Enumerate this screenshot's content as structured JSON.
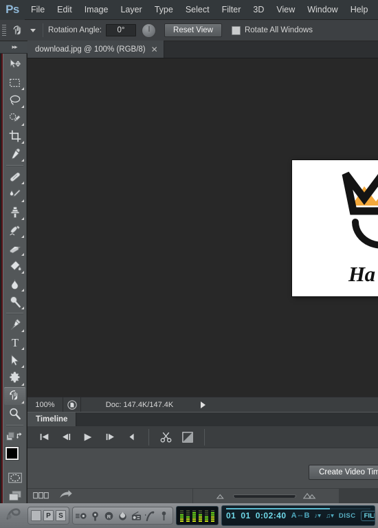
{
  "app": {
    "name": "Adobe Photoshop",
    "logo_text": "Ps"
  },
  "menubar": {
    "items": [
      {
        "label": "File"
      },
      {
        "label": "Edit"
      },
      {
        "label": "Image"
      },
      {
        "label": "Layer"
      },
      {
        "label": "Type"
      },
      {
        "label": "Select"
      },
      {
        "label": "Filter"
      },
      {
        "label": "3D"
      },
      {
        "label": "View"
      },
      {
        "label": "Window"
      },
      {
        "label": "Help"
      }
    ]
  },
  "options_bar": {
    "active_tool_icon": "rotate-view-tool-icon",
    "rotation_angle_label": "Rotation Angle:",
    "rotation_angle_value": "0°",
    "dial_icon": "rotation-dial-icon",
    "reset_view_label": "Reset View",
    "rotate_all_windows_label": "Rotate All Windows",
    "rotate_all_windows_checked": false
  },
  "toolbar": {
    "collapse_icon": "double-chevron-right-icon",
    "tools": [
      {
        "name": "move-tool",
        "icon": "move-tool-icon",
        "active": false,
        "has_submenu": false
      },
      {
        "name": "rectangular-marquee-tool",
        "icon": "marquee-tool-icon",
        "active": false,
        "has_submenu": true
      },
      {
        "name": "lasso-tool",
        "icon": "lasso-tool-icon",
        "active": false,
        "has_submenu": true
      },
      {
        "name": "quick-selection-tool",
        "icon": "quick-selection-tool-icon",
        "active": false,
        "has_submenu": true
      },
      {
        "name": "crop-tool",
        "icon": "crop-tool-icon",
        "active": false,
        "has_submenu": true
      },
      {
        "name": "eyedropper-tool",
        "icon": "eyedropper-tool-icon",
        "active": false,
        "has_submenu": true
      },
      {
        "name": "spot-healing-brush-tool",
        "icon": "healing-brush-tool-icon",
        "active": false,
        "has_submenu": true
      },
      {
        "name": "brush-tool",
        "icon": "brush-tool-icon",
        "active": false,
        "has_submenu": true
      },
      {
        "name": "clone-stamp-tool",
        "icon": "clone-stamp-tool-icon",
        "active": false,
        "has_submenu": true
      },
      {
        "name": "history-brush-tool",
        "icon": "history-brush-tool-icon",
        "active": false,
        "has_submenu": true
      },
      {
        "name": "eraser-tool",
        "icon": "eraser-tool-icon",
        "active": false,
        "has_submenu": true
      },
      {
        "name": "gradient-tool",
        "icon": "gradient-paint-bucket-tool-icon",
        "active": false,
        "has_submenu": true
      },
      {
        "name": "blur-tool",
        "icon": "blur-tool-icon",
        "active": false,
        "has_submenu": true
      },
      {
        "name": "dodge-tool",
        "icon": "dodge-tool-icon",
        "active": false,
        "has_submenu": true
      },
      {
        "name": "pen-tool",
        "icon": "pen-tool-icon",
        "active": false,
        "has_submenu": true
      },
      {
        "name": "horizontal-type-tool",
        "icon": "type-tool-icon",
        "active": false,
        "has_submenu": true
      },
      {
        "name": "path-selection-tool",
        "icon": "path-selection-tool-icon",
        "active": false,
        "has_submenu": true
      },
      {
        "name": "custom-shape-tool",
        "icon": "custom-shape-tool-icon",
        "active": false,
        "has_submenu": true
      },
      {
        "name": "rotate-view-tool",
        "icon": "rotate-view-tool-icon",
        "active": true,
        "has_submenu": true
      },
      {
        "name": "zoom-tool",
        "icon": "zoom-tool-icon",
        "active": false,
        "has_submenu": false
      }
    ],
    "foreground_color": "#000000",
    "background_color": "#ffffff",
    "swap_colors_icon": "swap-colors-icon",
    "default_colors_icon": "default-colors-icon",
    "quick_mask_icon": "quick-mask-mode-icon",
    "screen_mode_icon": "screen-mode-icon"
  },
  "document": {
    "tab_title": "download.jpg @ 100% (RGB/8)",
    "close_icon": "close-icon",
    "image_alt_text": "Ha",
    "crown_color": "#f4a93c",
    "ink_color": "#111111"
  },
  "status_bar": {
    "zoom_level": "100%",
    "thumbnail_icon": "document-preview-icon",
    "doc_info": "Doc: 147.4K/147.4K",
    "expand_icon": "play-arrow-icon"
  },
  "timeline": {
    "tab_label": "Timeline",
    "controls": [
      {
        "name": "go-to-first-frame-button",
        "icon": "skip-to-start-icon"
      },
      {
        "name": "previous-frame-button",
        "icon": "step-backward-icon"
      },
      {
        "name": "play-button",
        "icon": "play-icon"
      },
      {
        "name": "next-frame-button",
        "icon": "step-forward-icon"
      },
      {
        "name": "audio-button",
        "icon": "speaker-icon"
      },
      {
        "name": "split-clip-button",
        "icon": "scissors-icon"
      },
      {
        "name": "transition-button",
        "icon": "transition-icon"
      }
    ],
    "create_video_label": "Create Video Timeline",
    "footer": {
      "frame_mode_icon": "frame-thumbnails-icon",
      "render_icon": "render-video-arrow-icon",
      "zoom_out_icon": "zoom-out-small-mountain-icon",
      "zoom_in_icon": "zoom-in-large-mountain-icon",
      "zoom_value": 52
    }
  },
  "taskbar": {
    "app": "FL Studio",
    "left_icons": [
      {
        "name": "fl-studio-logo-icon"
      }
    ],
    "page_buttons": [
      {
        "label": "",
        "name": "pattern-blank-button"
      },
      {
        "label": "P",
        "name": "playlist-button"
      },
      {
        "label": "S",
        "name": "step-sequencer-button"
      }
    ],
    "plugin_icons": [
      {
        "name": "channel-rack-icon"
      },
      {
        "name": "mixer-icon"
      },
      {
        "name": "recorder-icon"
      },
      {
        "name": "burn-icon"
      },
      {
        "name": "radio-icon"
      },
      {
        "name": "effects-icon"
      },
      {
        "name": "microphone-icon"
      }
    ],
    "meter_label": "level-meter",
    "transport": {
      "pattern_number": "01",
      "bar_number": "01",
      "time_code": "0:02:40",
      "ab_label": "A⇔B",
      "snap_icon": "snap-dropdown-icon",
      "tempo_icon": "tempo-dropdown-icon",
      "disc_label": "DISC",
      "file_label": "FILE",
      "progress_percent": 72
    }
  }
}
